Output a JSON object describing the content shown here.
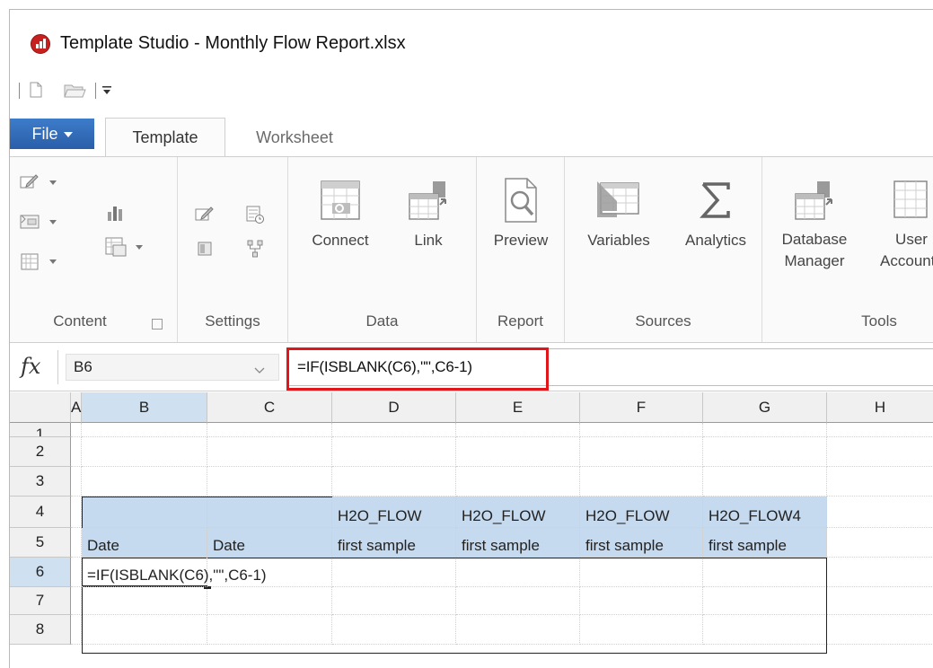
{
  "window": {
    "title": "Template Studio - Monthly Flow Report.xlsx",
    "app_icon": "chart-bars-icon",
    "accent_color": "#2a5ea9",
    "highlight_color": "#e0161b"
  },
  "quick_access": {
    "items": [
      "new-file-icon",
      "open-folder-icon",
      "customize-dropdown-icon"
    ]
  },
  "ribbon_tabs": {
    "file": "File",
    "tabs": [
      {
        "label": "Template",
        "active": true
      },
      {
        "label": "Worksheet",
        "active": false
      }
    ]
  },
  "ribbon_groups": {
    "content": {
      "label": "Content"
    },
    "settings": {
      "label": "Settings"
    },
    "data": {
      "label": "Data",
      "buttons": [
        {
          "label": "Connect",
          "icon": "connect-table-icon"
        },
        {
          "label": "Link",
          "icon": "link-table-icon"
        }
      ]
    },
    "report": {
      "label": "Report",
      "buttons": [
        {
          "label": "Preview",
          "icon": "preview-magnifier-icon"
        }
      ]
    },
    "sources": {
      "label": "Sources",
      "buttons": [
        {
          "label": "Variables",
          "icon": "variables-table-icon"
        },
        {
          "label": "Analytics",
          "icon": "sigma-icon"
        }
      ]
    },
    "tools": {
      "label": "Tools",
      "buttons": [
        {
          "label": "Database\nManager",
          "icon": "database-manager-icon"
        },
        {
          "label": "User\nAccounts",
          "icon": "user-accounts-icon"
        }
      ]
    }
  },
  "formula_bar": {
    "fx": "fx",
    "cell_ref": "B6",
    "formula": "=IF(ISBLANK(C6),\"\",C6-1)"
  },
  "grid": {
    "columns": [
      "A",
      "B",
      "C",
      "D",
      "E",
      "F",
      "G",
      "H"
    ],
    "selected_column": "B",
    "rows": [
      "1",
      "2",
      "3",
      "4",
      "5",
      "6",
      "7",
      "8"
    ],
    "selected_row": "6",
    "cells": {
      "D4": "H2O_FLOW",
      "E4": "H2O_FLOW",
      "F4": "H2O_FLOW",
      "G4": "H2O_FLOW4",
      "B5": "Date",
      "C5": "Date",
      "D5": "first sample",
      "E5": "first sample",
      "F5": "first sample",
      "G5": "first sample",
      "B6": "=IF(ISBLANK(C6),\"\",C6-1)"
    }
  }
}
